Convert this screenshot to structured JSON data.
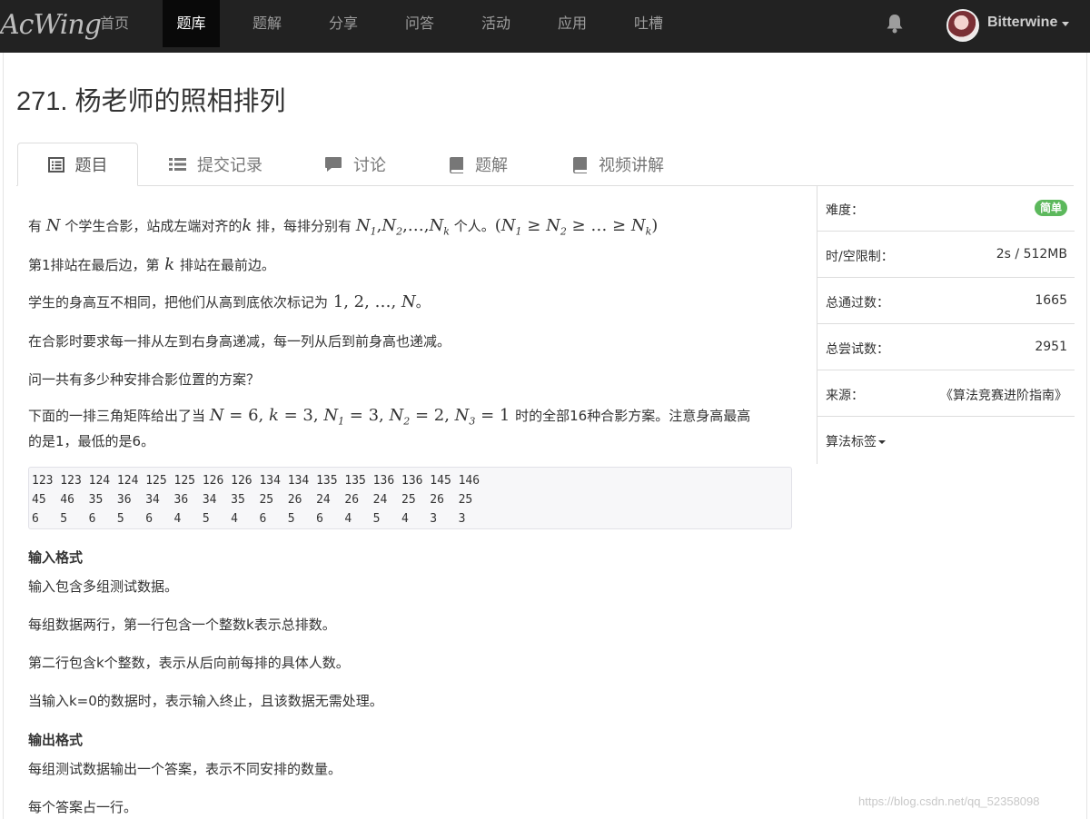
{
  "nav": {
    "logo": "AcWing",
    "items": [
      "首页",
      "题库",
      "题解",
      "分享",
      "问答",
      "活动",
      "应用",
      "吐槽"
    ],
    "active_index": 1,
    "user": "Bitterwine"
  },
  "problem": {
    "title": "271. 杨老师的照相排列"
  },
  "tabs": [
    "题目",
    "提交记录",
    "讨论",
    "题解",
    "视频讲解"
  ],
  "statement": {
    "p1_a": "有",
    "p1_b": "个学生合影，站成左端对齐的",
    "p1_c": "排，每排分别有",
    "p1_d": "个人。",
    "p2_a": "第1排站在最后边，第",
    "p2_b": "排站在最前边。",
    "p3_a": "学生的身高互不相同，把他们从高到底依次标记为",
    "p3_b": "。",
    "p4": "在合影时要求每一排从左到右身高递减，每一列从后到前身高也递减。",
    "p5": "问一共有多少种安排合影位置的方案？",
    "p6_a": "下面的一排三角矩阵给出了当",
    "p6_b": "时的全部16种合影方案。注意身高最高",
    "p6_c": "的是1，最低的是6。",
    "code": "123 123 124 124 125 125 126 126 134 134 135 135 136 136 145 146\n45  46  35  36  34  36  34  35  25  26  24  26  24  25  26  25\n6   5   6   5   6   4   5   4   6   5   6   4   5   4   3   3",
    "input_h": "输入格式",
    "input_1": "输入包含多组测试数据。",
    "input_2": "每组数据两行，第一行包含一个整数k表示总排数。",
    "input_3": "第二行包含k个整数，表示从后向前每排的具体人数。",
    "input_4": "当输入k=0的数据时，表示输入终止，且该数据无需处理。",
    "output_h": "输出格式",
    "output_1": "每组测试数据输出一个答案，表示不同安排的数量。",
    "output_2": "每个答案占一行。"
  },
  "side": {
    "difficulty_label": "难度：",
    "difficulty": "简单",
    "limit_label": "时/空限制：",
    "limit": "2s / 512MB",
    "pass_label": "总通过数：",
    "pass": "1665",
    "try_label": "总尝试数：",
    "try": "2951",
    "source_label": "来源：",
    "source": "《算法竞赛进阶指南》",
    "tags_label": "算法标签"
  },
  "watermark": "https://blog.csdn.net/qq_52358098",
  "colors": {
    "navbar": "#222222",
    "badge": "#5cb85c"
  }
}
